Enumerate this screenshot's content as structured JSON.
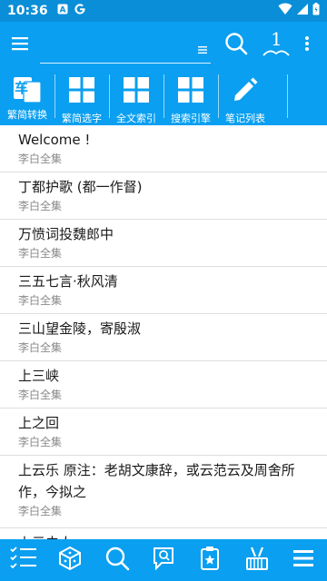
{
  "status_bar": {
    "time": "10:36",
    "icons": [
      "notification-a-icon",
      "google-icon",
      "wifi-icon",
      "signal-icon",
      "battery-icon"
    ]
  },
  "app_bar": {
    "search_value": "",
    "icons": [
      "menu-icon",
      "list-icon",
      "search-icon",
      "bookmark-1-icon",
      "more-vert-icon"
    ],
    "bookmark_number": "1"
  },
  "toolbar": {
    "items": [
      {
        "label": "繁简转换",
        "icon": "traditional-simplified-icon",
        "icon_text": "车"
      },
      {
        "label": "繁简选字",
        "icon": "grid-icon"
      },
      {
        "label": "全文索引",
        "icon": "grid-icon"
      },
      {
        "label": "搜索引擎",
        "icon": "grid-icon"
      },
      {
        "label": "笔记列表",
        "icon": "pencil-icon"
      }
    ]
  },
  "list": {
    "items": [
      {
        "title": "Welcome !",
        "subtitle": "李白全集"
      },
      {
        "title": "丁都护歌 (都一作督)",
        "subtitle": "李白全集"
      },
      {
        "title": "万愤词投魏郎中",
        "subtitle": "李白全集"
      },
      {
        "title": "三五七言·秋风清",
        "subtitle": "李白全集"
      },
      {
        "title": "三山望金陵，寄殷淑",
        "subtitle": "李白全集"
      },
      {
        "title": "上三峡",
        "subtitle": "李白全集"
      },
      {
        "title": "上之回",
        "subtitle": "李白全集"
      },
      {
        "title": "上云乐 原注：老胡文康辞，或云范云及周舍所作，今拟之",
        "subtitle": "李白全集"
      },
      {
        "title": "上元夫人",
        "subtitle": ""
      }
    ]
  },
  "bottom_nav": {
    "icons": [
      "checklist-icon",
      "cube-icon",
      "search-icon",
      "bubble-search-icon",
      "badge-icon",
      "tools-icon",
      "menu-lines-icon"
    ]
  },
  "colors": {
    "primary": "#0a9ff0",
    "status": "#0a8ed8",
    "text": "#1a1a1a",
    "subtext": "#8a8a8a"
  }
}
